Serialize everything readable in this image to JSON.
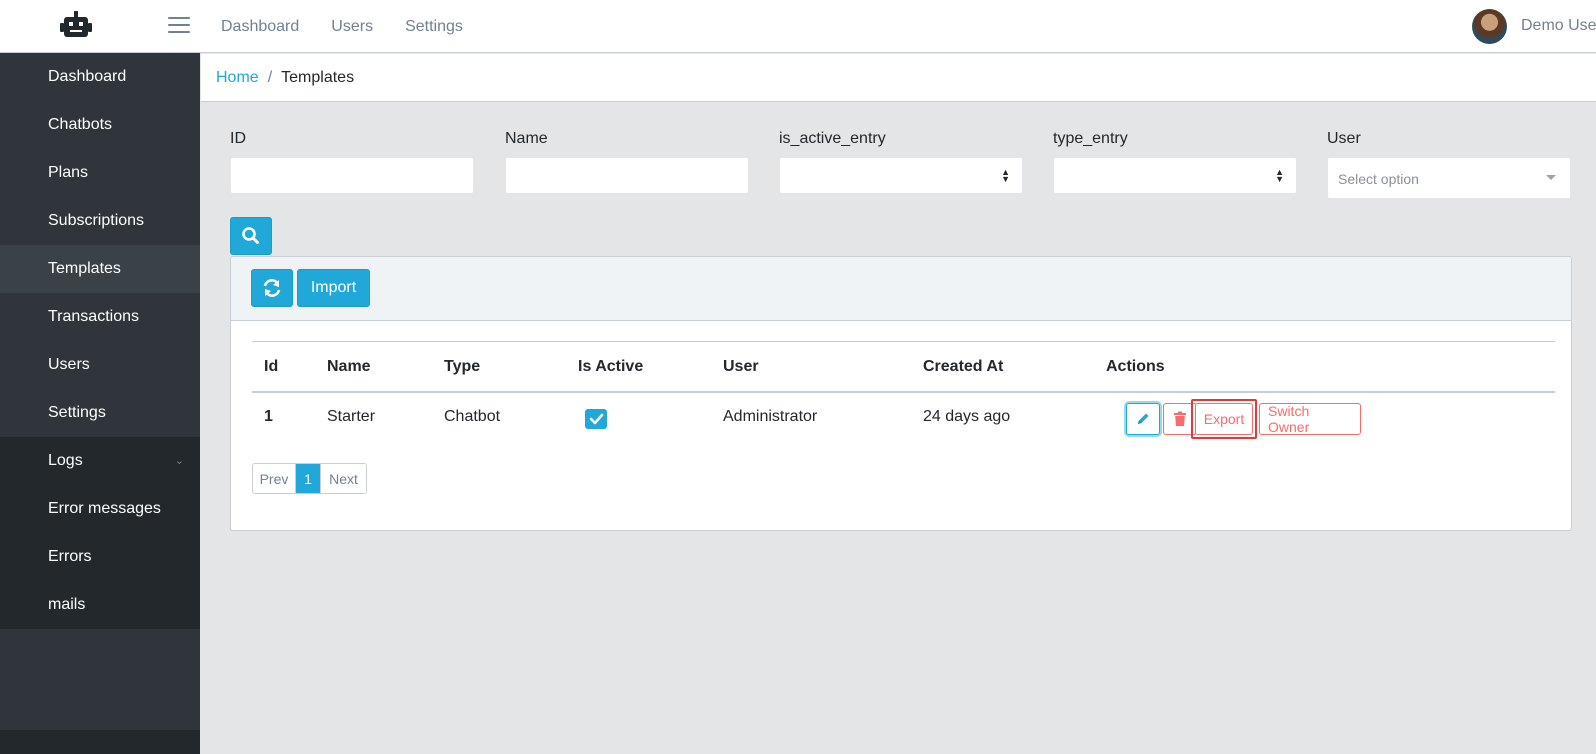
{
  "header": {
    "brand_icon": "robot-icon",
    "menu_icon": "hamburger-icon",
    "nav": [
      "Dashboard",
      "Users",
      "Settings"
    ],
    "user_name": "Demo User"
  },
  "sidebar": {
    "items": [
      {
        "label": "Dashboard"
      },
      {
        "label": "Chatbots"
      },
      {
        "label": "Plans"
      },
      {
        "label": "Subscriptions"
      },
      {
        "label": "Templates",
        "active": true
      },
      {
        "label": "Transactions"
      },
      {
        "label": "Users"
      },
      {
        "label": "Settings"
      }
    ],
    "logs_group": {
      "label": "Logs",
      "children": [
        "Error messages",
        "Errors",
        "mails"
      ]
    }
  },
  "breadcrumb": {
    "home": "Home",
    "current": "Templates"
  },
  "filters": {
    "id": {
      "label": "ID",
      "value": ""
    },
    "name": {
      "label": "Name",
      "value": ""
    },
    "is_active": {
      "label": "is_active_entry",
      "value": ""
    },
    "type": {
      "label": "type_entry",
      "value": ""
    },
    "user": {
      "label": "User",
      "placeholder": "Select option"
    }
  },
  "toolbar": {
    "refresh_icon": "refresh-icon",
    "import_label": "Import",
    "search_icon": "search-icon"
  },
  "table": {
    "columns": [
      "Id",
      "Name",
      "Type",
      "Is Active",
      "User",
      "Created At",
      "Actions"
    ],
    "rows": [
      {
        "id": "1",
        "name": "Starter",
        "type": "Chatbot",
        "is_active": true,
        "user": "Administrator",
        "created_at": "24 days ago"
      }
    ],
    "actions": {
      "export": "Export",
      "switch_owner": "Switch Owner"
    }
  },
  "pagination": {
    "prev": "Prev",
    "current": "1",
    "next": "Next"
  },
  "colors": {
    "primary": "#20a8d8",
    "danger": "#f86c6b",
    "sidebar": "#2f353a",
    "highlight": "#e03b3b"
  }
}
